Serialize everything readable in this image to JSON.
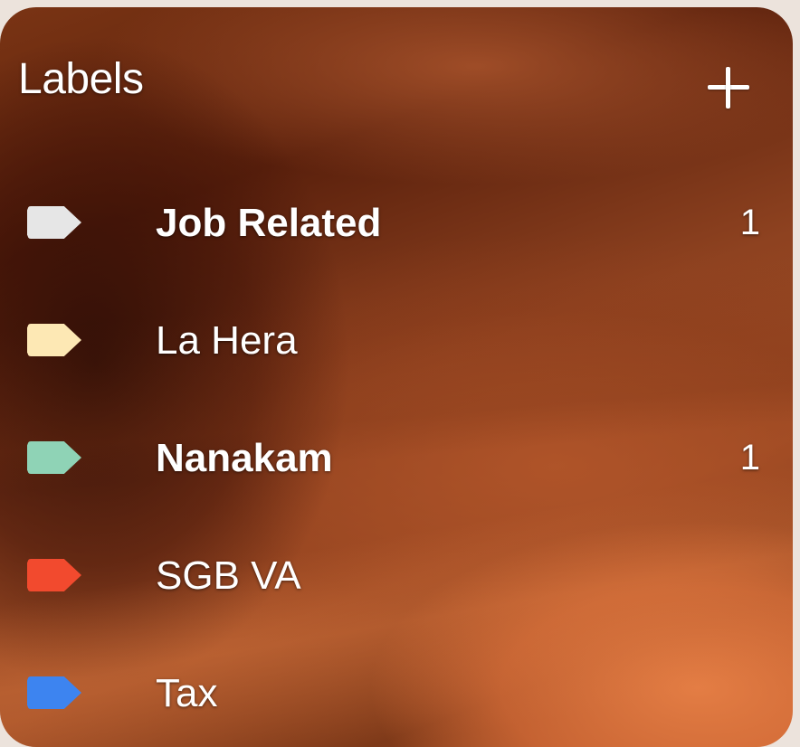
{
  "header": {
    "title": "Labels",
    "add_icon": "plus-icon"
  },
  "labels": [
    {
      "name": "Job Related",
      "count": "1",
      "color": "#e6e6e6",
      "bold": true
    },
    {
      "name": "La Hera",
      "count": "",
      "color": "#fde8b4",
      "bold": false
    },
    {
      "name": "Nanakam",
      "count": "1",
      "color": "#8fd3b6",
      "bold": true
    },
    {
      "name": "SGB VA",
      "count": "",
      "color": "#f24a2e",
      "bold": false
    },
    {
      "name": "Tax",
      "count": "",
      "color": "#3d84f0",
      "bold": false
    }
  ]
}
